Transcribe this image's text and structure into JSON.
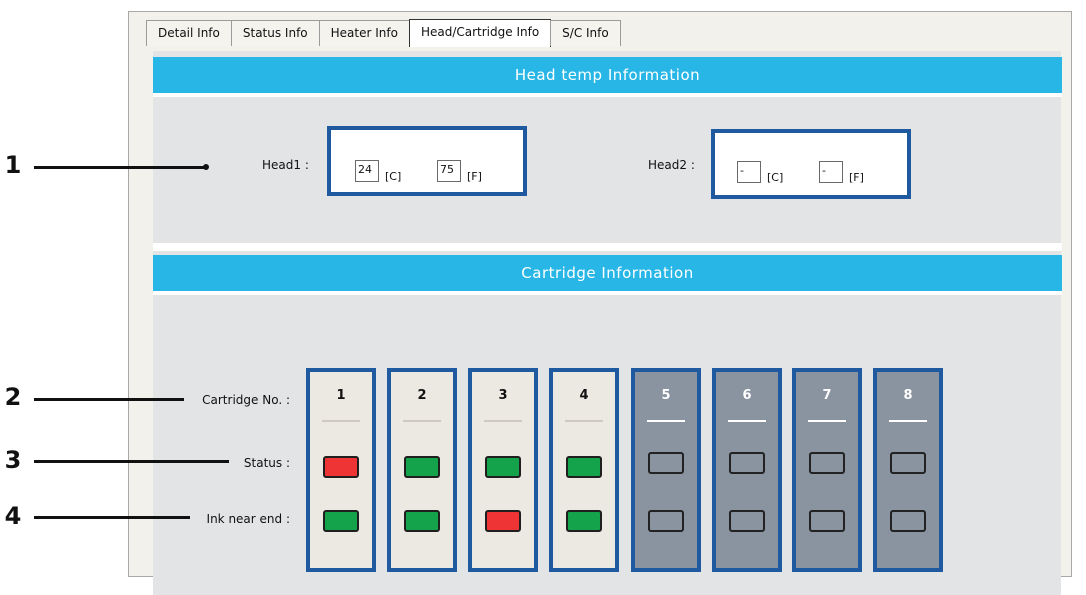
{
  "tabs": [
    {
      "label": "Detail Info"
    },
    {
      "label": "Status Info"
    },
    {
      "label": "Heater Info"
    },
    {
      "label": "Head/Cartridge Info"
    },
    {
      "label": "S/C Info"
    }
  ],
  "active_tab": "Head/Cartridge Info",
  "head_section": {
    "title": "Head temp Information",
    "head1": {
      "label": "Head1 :",
      "celsius": "24",
      "fahrenheit": "75",
      "c_unit": "[C]",
      "f_unit": "[F]"
    },
    "head2": {
      "label": "Head2 :",
      "celsius": "-",
      "fahrenheit": "-",
      "c_unit": "[C]",
      "f_unit": "[F]"
    }
  },
  "cartridge_section": {
    "title": "Cartridge Information",
    "labels": {
      "number": "Cartridge No. :",
      "status": "Status :",
      "ink_near_end": "Ink near end :"
    },
    "cartridges": [
      {
        "number": "1",
        "enabled": true,
        "status": "red",
        "ink_near_end": "green"
      },
      {
        "number": "2",
        "enabled": true,
        "status": "green",
        "ink_near_end": "green"
      },
      {
        "number": "3",
        "enabled": true,
        "status": "green",
        "ink_near_end": "red"
      },
      {
        "number": "4",
        "enabled": true,
        "status": "green",
        "ink_near_end": "green"
      },
      {
        "number": "5",
        "enabled": false,
        "status": "gray",
        "ink_near_end": "gray"
      },
      {
        "number": "6",
        "enabled": false,
        "status": "gray",
        "ink_near_end": "gray"
      },
      {
        "number": "7",
        "enabled": false,
        "status": "gray",
        "ink_near_end": "gray"
      },
      {
        "number": "8",
        "enabled": false,
        "status": "gray",
        "ink_near_end": "gray"
      }
    ]
  },
  "callouts": [
    {
      "number": "1"
    },
    {
      "number": "2"
    },
    {
      "number": "3"
    },
    {
      "number": "4"
    }
  ],
  "colors": {
    "accent": "#27b6e6",
    "frame": "#1f5aa0",
    "ok": "#14a24a",
    "error": "#ee3434",
    "disabled": "#8a93a0"
  }
}
